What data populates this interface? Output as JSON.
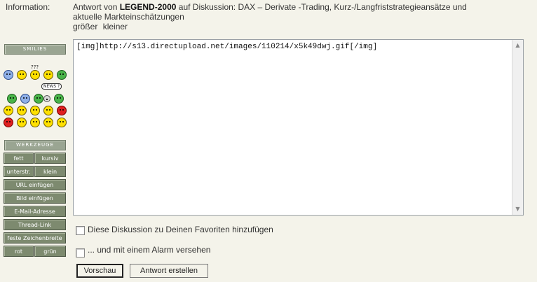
{
  "info": {
    "label": "Information:",
    "prefix": "Antwort von",
    "author": "LEGEND-2000",
    "middle": "auf Diskussion: DAX – Derivate -Trading, Kurz-/Langfriststrategieansätze und",
    "line2": "aktuelle Markteinschätzungen",
    "size_bigger": "größer",
    "size_smaller": "kleiner"
  },
  "smilies": {
    "title": "SMILIES",
    "question_marks": "???",
    "bubble_text": "NEWS ?"
  },
  "tools": {
    "title": "WERKZEUGE",
    "bold": "fett",
    "italic": "kursiv",
    "underline": "unterstr.",
    "small": "klein",
    "insert_url": "URL einfügen",
    "insert_image": "Bild einfügen",
    "email": "E-Mail-Adresse",
    "thread_link": "Thread-Link",
    "fixed_width": "feste Zeichenbreite",
    "red": "rot",
    "green": "grün"
  },
  "editor": {
    "content": "[img]http://s13.directupload.net/images/110214/x5k49dwj.gif[/img]"
  },
  "options": {
    "favorite": "Diese Diskussion zu Deinen Favoriten hinzufügen",
    "alarm": "... und mit einem Alarm versehen"
  },
  "buttons": {
    "preview": "Vorschau",
    "submit": "Antwort erstellen"
  }
}
